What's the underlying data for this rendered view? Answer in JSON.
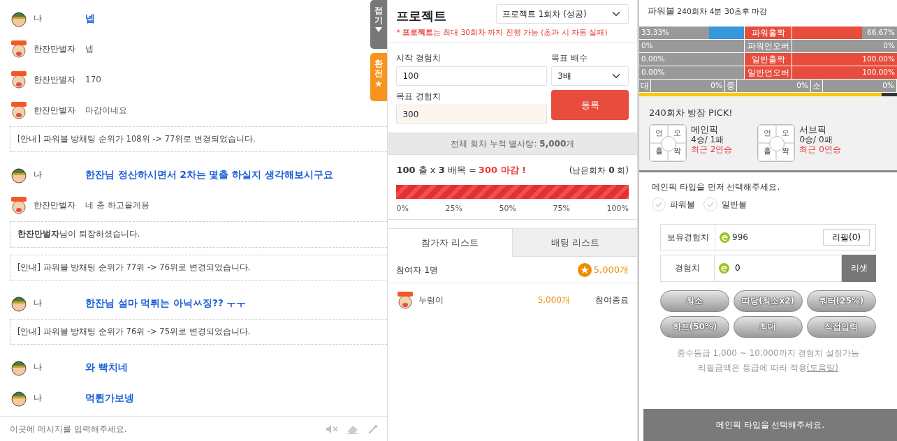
{
  "chat": {
    "messages": [
      {
        "kind": "me",
        "name": "나",
        "text": "넵"
      },
      {
        "kind": "user",
        "name": "한잔만벌자",
        "text": "넵"
      },
      {
        "kind": "user",
        "name": "한잔만벌자",
        "text": "170"
      },
      {
        "kind": "user",
        "name": "한잔만벌자",
        "text": "마감이네요"
      },
      {
        "kind": "notice",
        "text": "[안내] 파워볼 방채팅 순위가 108위 -> 77위로 변경되었습니다."
      },
      {
        "kind": "me",
        "name": "나",
        "text": "한잔님 정산하시면서 2차는 몇출 하실지 생각해보시구요"
      },
      {
        "kind": "user",
        "name": "한잔만벌자",
        "text": "네 충 하고올게용"
      },
      {
        "kind": "notice",
        "text": "**한잔만벌자**님이 퇴장하셨습니다."
      },
      {
        "kind": "notice",
        "text": "[안내] 파워볼 방채팅 순위가 77위 -> 76위로 변경되었습니다."
      },
      {
        "kind": "me",
        "name": "나",
        "text": "한잔님 설마 먹튀는 아닉ㅆ징?? ㅜㅜ"
      },
      {
        "kind": "notice",
        "text": "[안내] 파워볼 방채팅 순위가 76위 -> 75위로 변경되었습니다."
      },
      {
        "kind": "me",
        "name": "나",
        "text": "와 빡치네"
      },
      {
        "kind": "me",
        "name": "나",
        "text": "먹튄가보넹"
      }
    ],
    "input": {
      "placeholder": "이곳에 메시지를 입력해주세요."
    },
    "side_tabs": [
      {
        "kind": "fold",
        "label": "접기"
      },
      {
        "kind": "exchange",
        "label": "환전"
      }
    ]
  },
  "project": {
    "title": "프로젝트",
    "select": "프로젝트 1회차 (성공)",
    "note": "* **프로젝트**는 최대 30회차 까지 진행 가능 (초과 시 자동 실패)",
    "start_label": "시작 경험치",
    "start_value": "100",
    "multiplier_label": "목표 배수",
    "multiplier": "3배",
    "target_label": "목표 경험치",
    "target_value": "300",
    "register": "등록",
    "total": "전체 회차 누적 별사탕: **5,000**개",
    "formula": "**100** 출 x **3** 배목 =",
    "result": "300 마감 !",
    "remaining": "(남은회차 **0** 회)",
    "progress": {
      "level": 1.0,
      "ticks": [
        "0%",
        "25%",
        "50%",
        "75%",
        "100%"
      ]
    },
    "tabs": [
      {
        "label": "참가자 리스트",
        "selected": true
      },
      {
        "label": "배팅 리스트",
        "selected": false
      }
    ],
    "participants_count": "참여자 1명",
    "participants_total": "5,000개",
    "participants": [
      {
        "name": "누렁이",
        "amount": "5,000개",
        "status": "참여종료"
      }
    ]
  },
  "powerball": {
    "game": "파워볼",
    "round": "240회차 4분 30초후 마감",
    "stats": [
      {
        "label": "파워홀짝",
        "highlight": true,
        "left": {
          "text": "33.33%",
          "level": 0.3333
        },
        "right": {
          "text": "66.67%",
          "level": 0.6667
        }
      },
      {
        "label": "파워언오버",
        "highlight": false,
        "left": {
          "text": "0%",
          "level": 0
        },
        "right": {
          "text": "0%",
          "level": 0
        }
      },
      {
        "label": "일반홀짝",
        "highlight": true,
        "left": {
          "text": "0.00%",
          "level": 0
        },
        "right": {
          "text": "100.00%",
          "level": 1.0
        }
      },
      {
        "label": "일반언오버",
        "highlight": true,
        "left": {
          "text": "0.00%",
          "level": 0
        },
        "right": {
          "text": "100.00%",
          "level": 1.0
        }
      }
    ],
    "sizes": [
      {
        "label": "대",
        "value": "0%"
      },
      {
        "label": "중",
        "value": "0%"
      },
      {
        "label": "소",
        "value": "0%"
      }
    ],
    "timer": {
      "level": 0.94
    },
    "pick_title": "240회차 방장 PICK!",
    "picks": [
      {
        "cells": [
          "언",
          "오",
          "홀",
          "짝"
        ],
        "name": "메인픽",
        "record": "4승/ 1패",
        "streak": "최근 2연승"
      },
      {
        "cells": [
          "언",
          "오",
          "홀",
          "짝"
        ],
        "name": "서브픽",
        "record": "0승/ 0패",
        "streak": "최근 0연승"
      }
    ],
    "type_prompt": "메인픽 타입을 먼저 선택해주세요.",
    "types": [
      {
        "label": "파워볼",
        "checked": false
      },
      {
        "label": "일반볼",
        "checked": false
      }
    ],
    "held_label": "보유경험치",
    "held_value": "996",
    "refill": "리필(0)",
    "exp_label": "경험치",
    "exp_value": "0",
    "reset": "리셋",
    "amount_buttons": [
      "최소",
      "따당(최소x2)",
      "쿼터(25%)",
      "하프(50%)",
      "최대",
      "직접입력"
    ],
    "notes": [
      "중수등급 1,000 ~ 10,000까지 경험치 설정가능",
      "리필금액은 등급에 따라 적용"
    ],
    "help_link": "(도움말)",
    "submit": "메인픽 타입을 선택해주세요."
  }
}
